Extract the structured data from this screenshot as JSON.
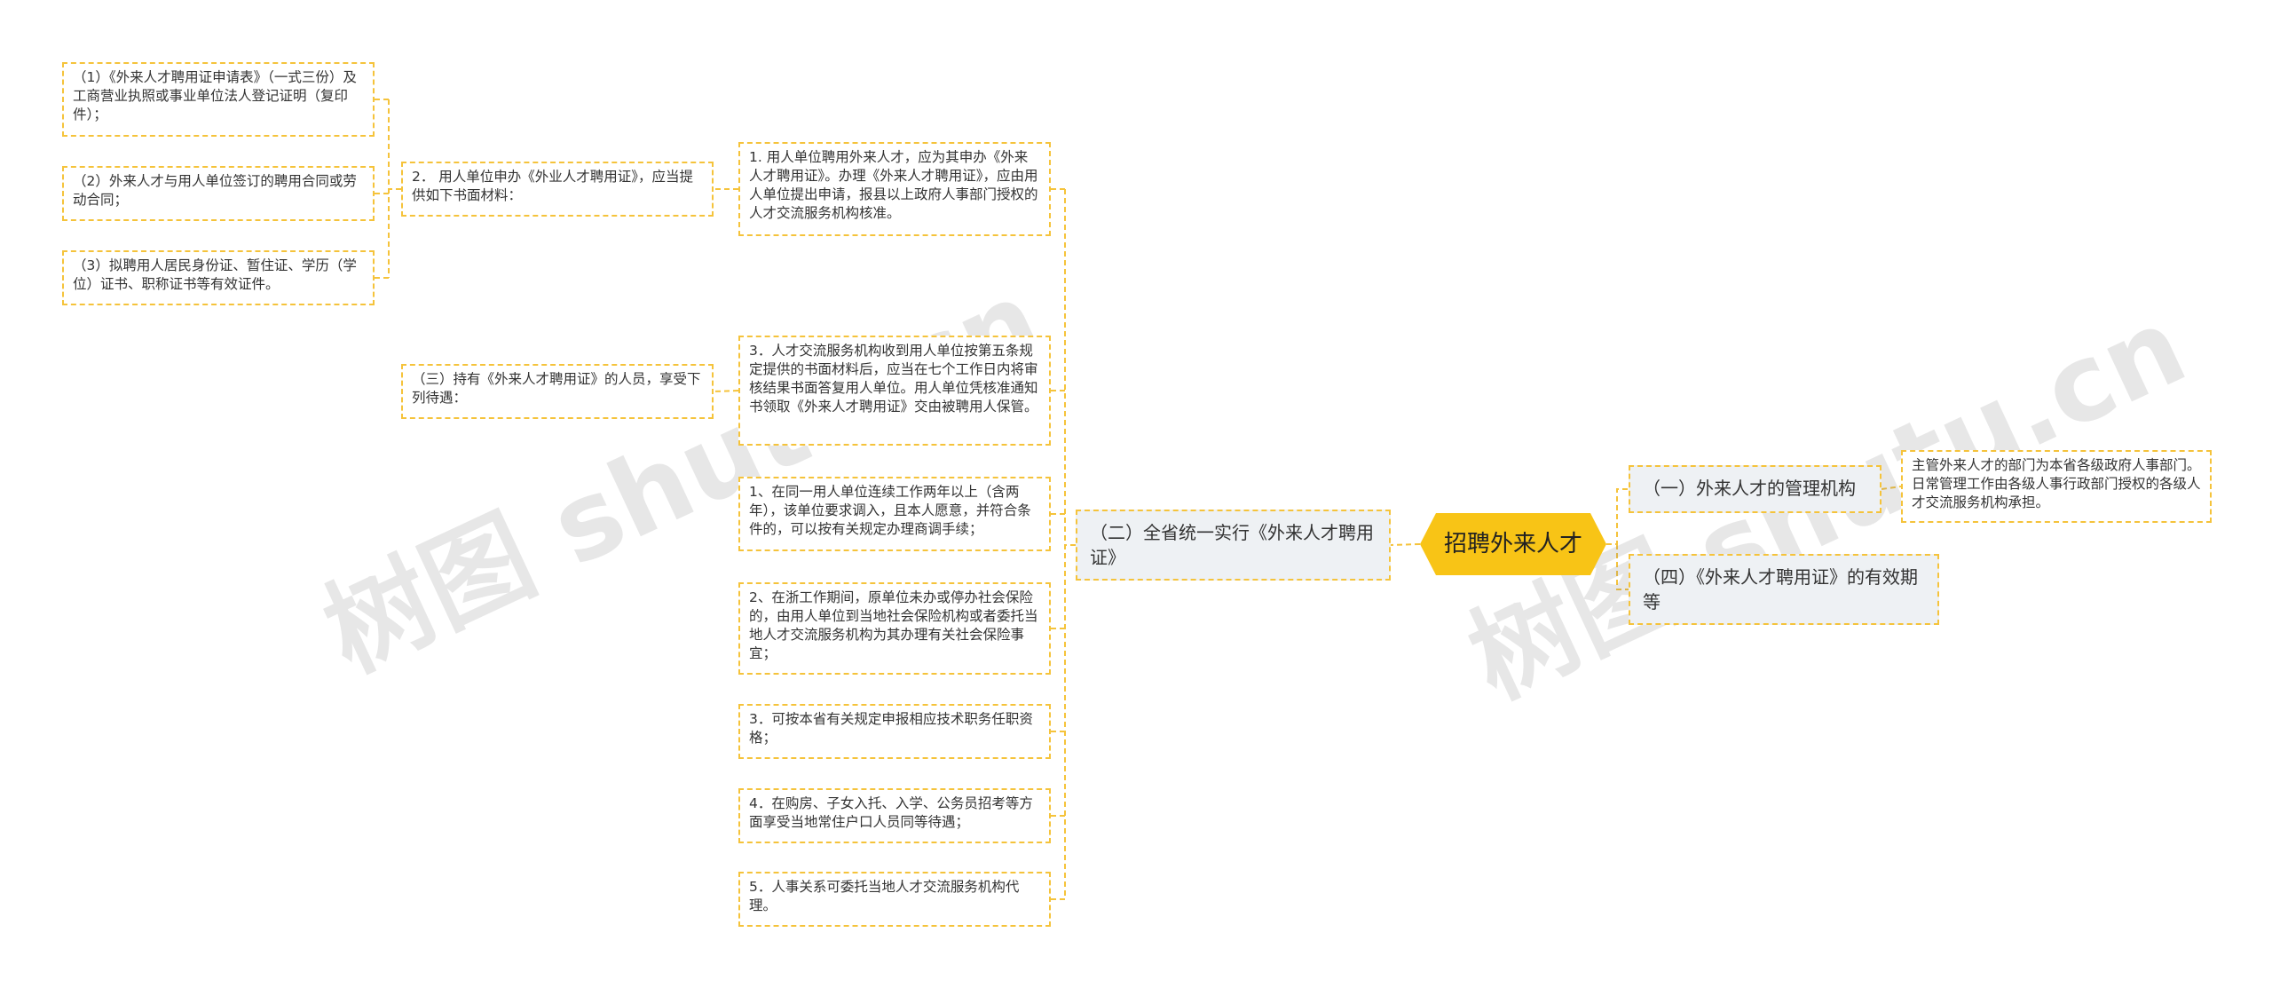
{
  "root": "招聘外来人才",
  "watermark": "树图 shutu.cn",
  "nodes": {
    "n1": "（一）外来人才的管理机构",
    "n1a": "主管外来人才的部门为本省各级政府人事部门。日常管理工作由各级人事行政部门授权的各级人才交流服务机构承担。",
    "n4": "（四）《外来人才聘用证》的有效期等",
    "n2": "（二）全省统一实行《外来人才聘用证》",
    "a1": "1. 用人单位聘用外来人才，应为其申办《外来人才聘用证》。办理《外来人才聘用证》，应由用人单位提出申请，报县以上政府人事部门授权的人才交流服务机构核准。",
    "a2": "2． 用人单位申办《外业人才聘用证》，应当提供如下书面材料：",
    "m1": "（1）《外来人才聘用证申请表》（一式三份）及工商营业执照或事业单位法人登记证明（复印件）；",
    "m2": "（2）外来人才与用人单位签订的聘用合同或劳动合同；",
    "m3": "（3）拟聘用人居民身份证、暂住证、学历（学位）证书、职称证书等有效证件。",
    "a3": "3．人才交流服务机构收到用人单位按第五条规定提供的书面材料后，应当在七个工作日内将审核结果书面答复用人单位。用人单位凭核准通知书领取《外来人才聘用证》交由被聘用人保管。",
    "n3": "（三）持有《外来人才聘用证》的人员，享受下列待遇：",
    "b1": "1、在同一用人单位连续工作两年以上（含两年），该单位要求调入，且本人愿意，并符合条件的，可以按有关规定办理商调手续；",
    "b2": "2、在浙工作期间，原单位未办或停办社会保险的，由用人单位到当地社会保险机构或者委托当地人才交流服务机构为其办理有关社会保险事宜；",
    "b3": "3．可按本省有关规定申报相应技术职务任职资格；",
    "b4": "4．在购房、子女入托、入学、公务员招考等方面享受当地常住户口人员同等待遇；",
    "b5": "5．人事关系可委托当地人才交流服务机构代理。"
  }
}
